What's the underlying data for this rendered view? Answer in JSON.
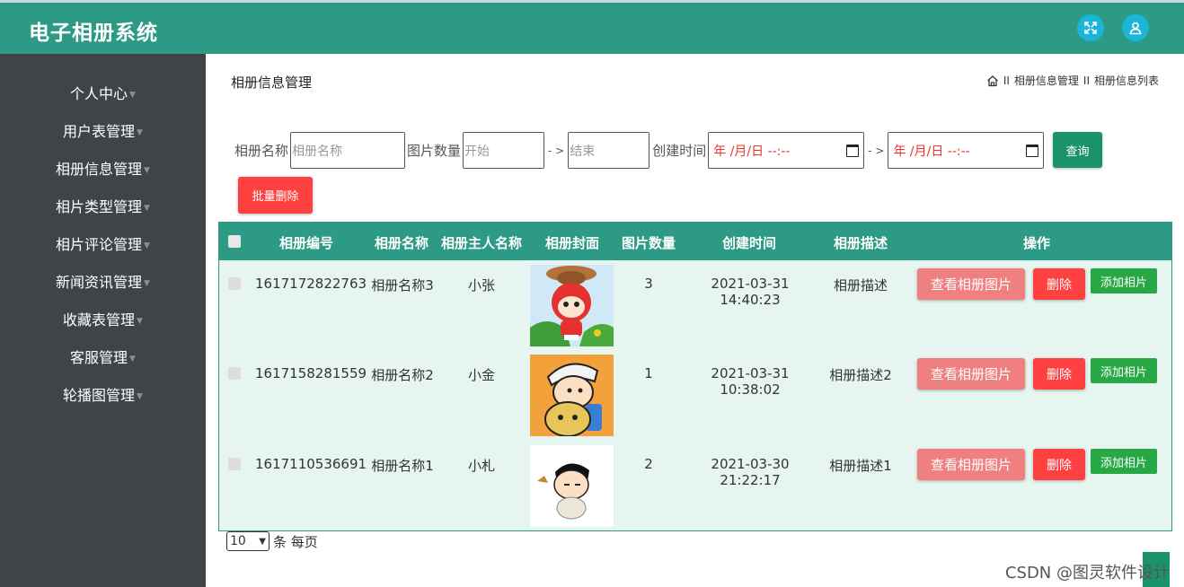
{
  "header": {
    "title": "电子相册系统"
  },
  "sidebar": {
    "items": [
      {
        "label": "个人中心"
      },
      {
        "label": "用户表管理"
      },
      {
        "label": "相册信息管理"
      },
      {
        "label": "相片类型管理"
      },
      {
        "label": "相片评论管理"
      },
      {
        "label": "新闻资讯管理"
      },
      {
        "label": "收藏表管理"
      },
      {
        "label": "客服管理"
      },
      {
        "label": "轮播图管理"
      }
    ]
  },
  "page": {
    "title": "相册信息管理",
    "breadcrumb": [
      "相册信息管理",
      "相册信息列表"
    ],
    "breadcrumb_sep": "II"
  },
  "search": {
    "name_label": "相册名称",
    "name_placeholder": "相册名称",
    "count_label": "图片数量",
    "count_start_placeholder": "开始",
    "count_end_placeholder": "结束",
    "range_sep": "- >",
    "time_label": "创建时间",
    "date_placeholder": "年 /月/日  --:--",
    "query_label": "查询",
    "batch_delete_label": "批量删除"
  },
  "table": {
    "columns": [
      "相册编号",
      "相册名称",
      "相册主人名称",
      "相册封面",
      "图片数量",
      "创建时间",
      "相册描述",
      "操作"
    ],
    "rows": [
      {
        "id": "1617172822763",
        "name": "相册名称3",
        "owner": "小张",
        "count": "3",
        "created": "2021-03-31 14:40:23",
        "desc": "相册描述"
      },
      {
        "id": "1617158281559",
        "name": "相册名称2",
        "owner": "小金",
        "count": "1",
        "created": "2021-03-31 10:38:02",
        "desc": "相册描述2"
      },
      {
        "id": "1617110536691",
        "name": "相册名称1",
        "owner": "小札",
        "count": "2",
        "created": "2021-03-30 21:22:17",
        "desc": "相册描述1"
      }
    ],
    "actions": {
      "view": "查看相册图片",
      "delete": "删除",
      "add": "添加相片"
    }
  },
  "pager": {
    "page_size": "10",
    "unit": "条 每页"
  },
  "watermark": "CSDN @图灵软件设计",
  "colors": {
    "primary": "#2d9a86",
    "danger": "#ff4040",
    "success": "#27a844",
    "sidebar": "#3f4448"
  }
}
